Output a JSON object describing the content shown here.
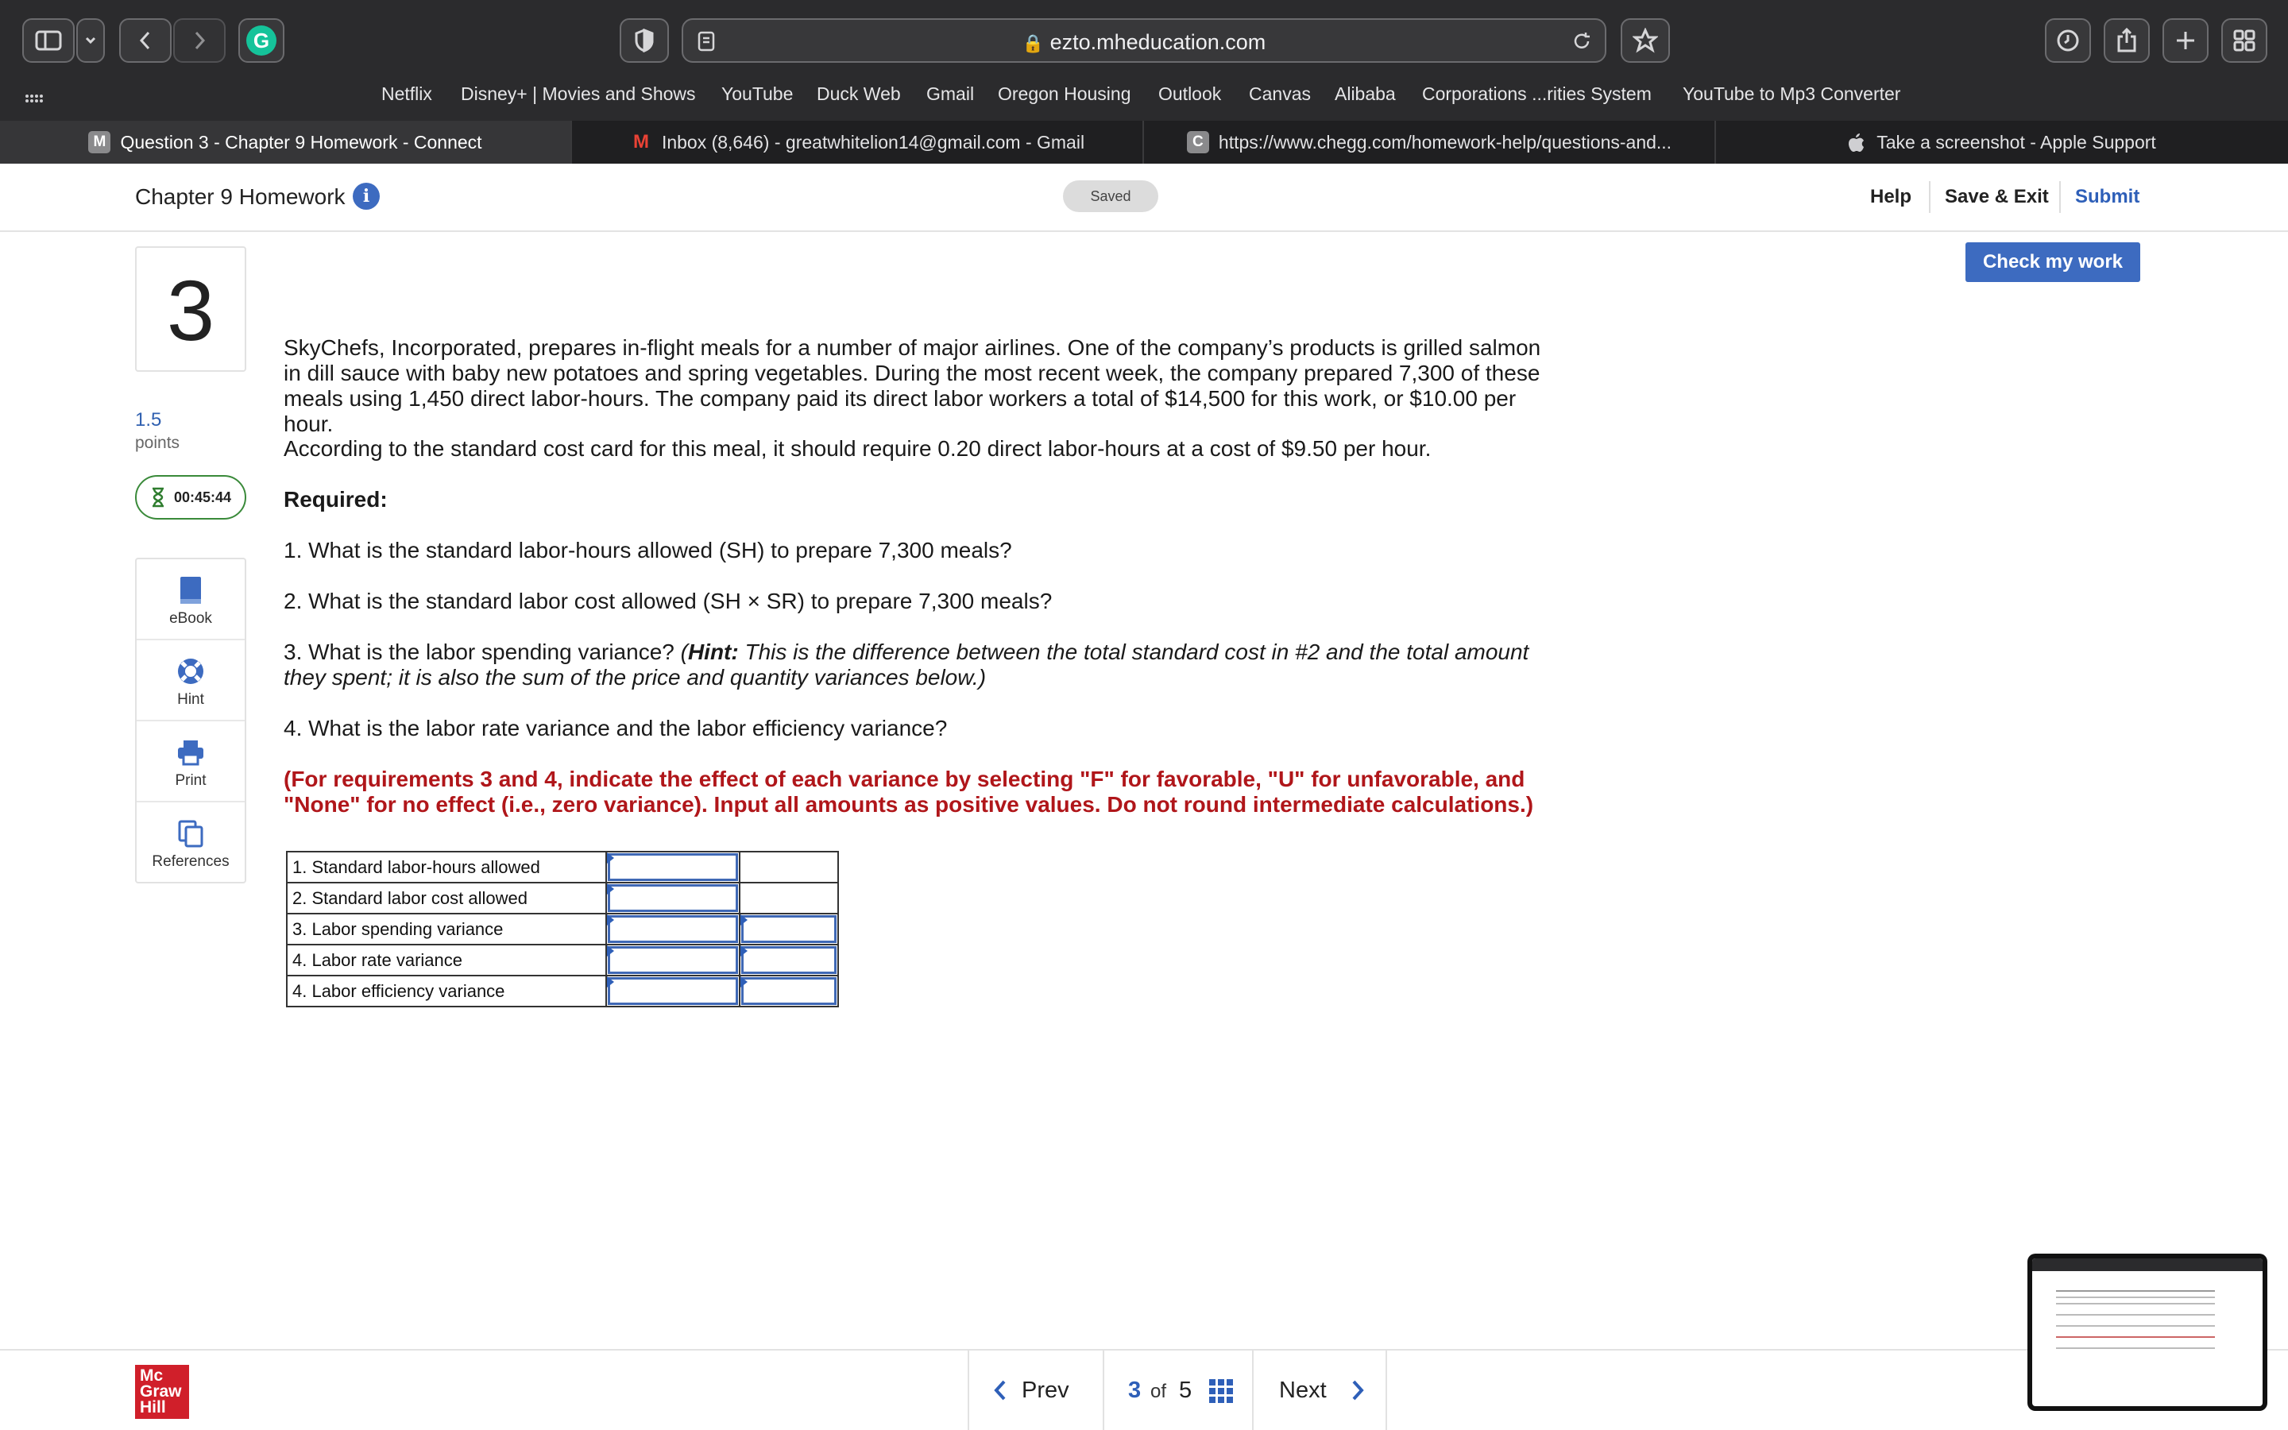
{
  "browser": {
    "url": "ezto.mheducation.com",
    "bookmarks": [
      "Netflix",
      "Disney+ | Movies and Shows",
      "YouTube",
      "Duck Web",
      "Gmail",
      "Oregon Housing",
      "Outlook",
      "Canvas",
      "Alibaba",
      "Corporations ...rities System",
      "YouTube to Mp3 Converter"
    ],
    "tabs": [
      {
        "icon": "M",
        "label": "Question 3 - Chapter 9 Homework - Connect"
      },
      {
        "icon": "M",
        "label": "Inbox (8,646) - greatwhitelion14@gmail.com - Gmail"
      },
      {
        "icon": "C",
        "label": "https://www.chegg.com/homework-help/questions-and..."
      },
      {
        "icon": "",
        "label": "Take a screenshot - Apple Support"
      }
    ]
  },
  "header": {
    "title": "Chapter 9 Homework",
    "saved": "Saved",
    "help": "Help",
    "save_exit": "Save & Exit",
    "submit": "Submit",
    "check": "Check my work"
  },
  "rail": {
    "question_number": "3",
    "points_value": "1.5",
    "points_label": "points",
    "timer": "00:45:44",
    "tools": [
      "eBook",
      "Hint",
      "Print",
      "References"
    ]
  },
  "question": {
    "intro": "SkyChefs, Incorporated, prepares in-flight meals for a number of major airlines. One of the company’s products is grilled salmon in dill sauce with baby new potatoes and spring vegetables. During the most recent week, the company prepared 7,300 of these meals using 1,450 direct labor-hours. The company paid its direct labor workers a total of $14,500 for this work, or $10.00 per hour.",
    "standard": "According to the standard cost card for this meal, it should require 0.20 direct labor-hours at a cost of $9.50 per hour.",
    "required": "Required:",
    "q1": "1. What is the standard labor-hours allowed (SH) to prepare 7,300 meals?",
    "q2": "2. What is the standard labor cost allowed (SH × SR) to prepare 7,300 meals?",
    "q3_start": "3. What is the labor spending variance? ",
    "q3_hint_open": "(",
    "q3_hint_label": "Hint:",
    "q3_hint_text": " This is the difference between the total standard cost in #2 and the total amount they spent; it is also the sum of the price and quantity variances below.)",
    "q4": "4. What is the labor rate variance and the labor efficiency variance?",
    "instructions": "(For requirements 3 and 4, indicate the effect of each variance by selecting \"F\" for favorable, \"U\" for unfavorable, and \"None\" for no effect (i.e., zero variance). Input all amounts as positive values. Do not round intermediate calculations.)"
  },
  "answer_table": {
    "rows": [
      {
        "label": "1. Standard labor-hours allowed",
        "has_select": false
      },
      {
        "label": "2. Standard labor cost allowed",
        "has_select": false
      },
      {
        "label": "3. Labor spending variance",
        "has_select": true
      },
      {
        "label": "4. Labor rate variance",
        "has_select": true
      },
      {
        "label": "4. Labor efficiency variance",
        "has_select": true
      }
    ]
  },
  "footer": {
    "logo": [
      "Mc",
      "Graw",
      "Hill"
    ],
    "prev": "Prev",
    "current": "3",
    "of": "of",
    "total": "5",
    "next": "Next"
  }
}
